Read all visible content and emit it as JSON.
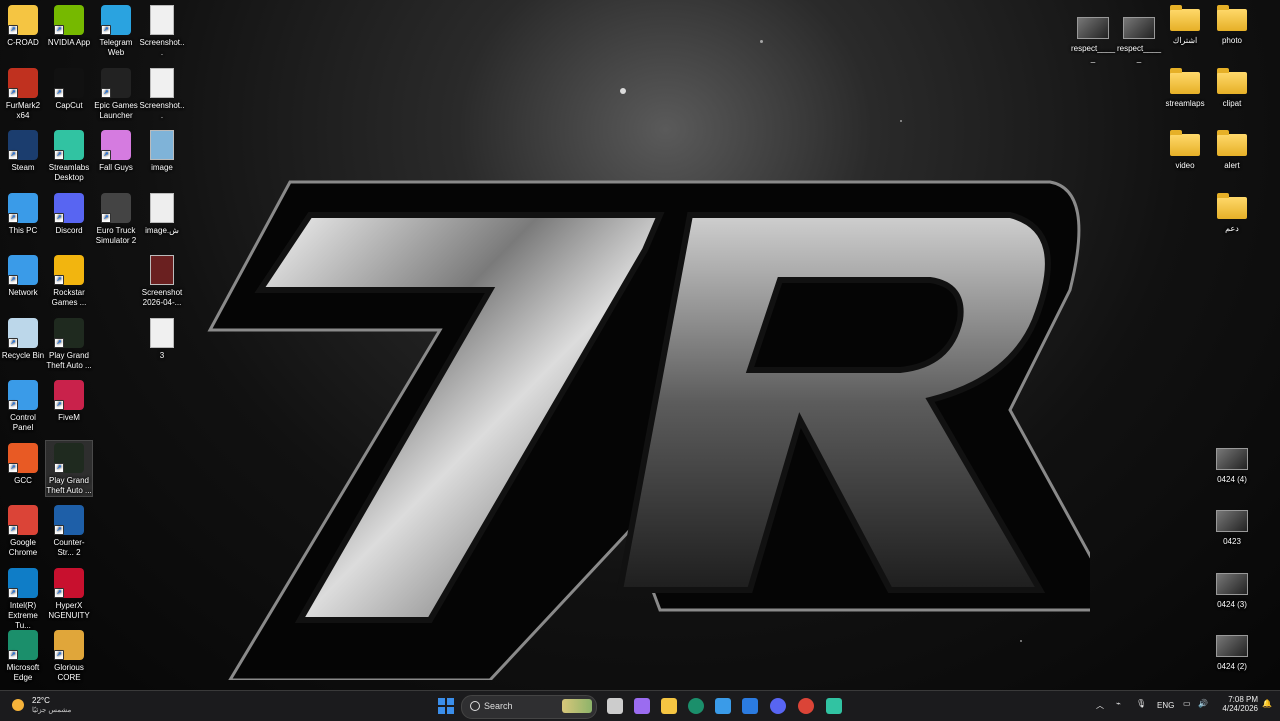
{
  "desktop_left": [
    {
      "label": "C-ROAD",
      "icon": "c-road-folder-icon",
      "color": "#f5c542"
    },
    {
      "label": "NVIDIA App",
      "icon": "nvidia-icon",
      "color": "#76b900"
    },
    {
      "label": "Telegram Web",
      "icon": "telegram-icon",
      "color": "#2aa3e0"
    },
    {
      "label": "Screenshot...",
      "icon": "screenshot-file-icon",
      "color": "#f0f0f0"
    },
    {
      "label": "FurMark2 x64",
      "icon": "furmark-icon",
      "color": "#c0311f"
    },
    {
      "label": "CapCut",
      "icon": "capcut-icon",
      "color": "#111111"
    },
    {
      "label": "Epic Games Launcher",
      "icon": "epic-games-icon",
      "color": "#222222"
    },
    {
      "label": "Screenshot...",
      "icon": "screenshot-file-icon",
      "color": "#f0f0f0"
    },
    {
      "label": "Steam",
      "icon": "steam-icon",
      "color": "#1b3d6e"
    },
    {
      "label": "Streamlabs Desktop",
      "icon": "streamlabs-icon",
      "color": "#31c3a2"
    },
    {
      "label": "Fall Guys",
      "icon": "fall-guys-icon",
      "color": "#d57be0"
    },
    {
      "label": "image",
      "icon": "image-file-icon",
      "color": "#7fb3d8"
    },
    {
      "label": "This PC",
      "icon": "this-pc-icon",
      "color": "#3a9be8"
    },
    {
      "label": "Discord",
      "icon": "discord-icon",
      "color": "#5865f2"
    },
    {
      "label": "Euro Truck Simulator 2",
      "icon": "euro-truck-icon",
      "color": "#444444"
    },
    {
      "label": "image.ش",
      "icon": "image-file-icon",
      "color": "#eeeeee"
    },
    {
      "label": "Network",
      "icon": "network-icon",
      "color": "#3a9be8"
    },
    {
      "label": "Rockstar Games ...",
      "icon": "rockstar-icon",
      "color": "#f2b50f"
    },
    {
      "label": "Screenshot 2026-04-...",
      "icon": "screenshot-file-icon",
      "color": "#6a2020"
    },
    {
      "label": "Recycle Bin",
      "icon": "recycle-bin-icon",
      "color": "#bcd7ea"
    },
    {
      "label": "Play Grand Theft Auto ...",
      "icon": "gta-v-icon",
      "color": "#1f2a1f"
    },
    {
      "label": "3",
      "icon": "image-file-icon",
      "color": "#f0f0f0"
    },
    {
      "label": "Control Panel",
      "icon": "control-panel-icon",
      "color": "#3a9be8"
    },
    {
      "label": "FiveM",
      "icon": "fivem-icon",
      "color": "#c9224b"
    },
    {
      "label": "GCC",
      "icon": "gcc-icon",
      "color": "#e85a24"
    },
    {
      "label": "Play Grand Theft Auto ...",
      "icon": "gta-v-icon",
      "color": "#1f2a1f"
    },
    {
      "label": "Google Chrome",
      "icon": "chrome-icon",
      "color": "#db4437"
    },
    {
      "label": "Counter-Str... 2",
      "icon": "cs2-icon",
      "color": "#1e5fa8"
    },
    {
      "label": "Intel(R) Extreme Tu...",
      "icon": "intel-xtu-icon",
      "color": "#0f7dc7"
    },
    {
      "label": "HyperX NGENUITY",
      "icon": "hyperx-icon",
      "color": "#c8102e"
    },
    {
      "label": "Microsoft Edge",
      "icon": "edge-icon",
      "color": "#1b8f6b"
    },
    {
      "label": "Glorious CORE",
      "icon": "glorious-icon",
      "color": "#e0a63a"
    }
  ],
  "desktop_right": [
    {
      "label": "respect_____",
      "icon": "thumbnail-icon",
      "type": "thumb"
    },
    {
      "label": "respect_____",
      "icon": "thumbnail-icon",
      "type": "thumb"
    },
    {
      "label": "اشتراك",
      "icon": "folder-icon",
      "type": "folder"
    },
    {
      "label": "photo",
      "icon": "folder-icon",
      "type": "folder"
    },
    {
      "label": "streamlaps",
      "icon": "folder-icon",
      "type": "folder"
    },
    {
      "label": "clipat",
      "icon": "folder-icon",
      "type": "folder"
    },
    {
      "label": "video",
      "icon": "folder-icon",
      "type": "folder"
    },
    {
      "label": "alert",
      "icon": "folder-icon",
      "type": "folder"
    },
    {
      "label": "دعم",
      "icon": "folder-icon",
      "type": "folder"
    },
    {
      "label": "0424 (4)",
      "icon": "video-thumbnail-icon",
      "type": "thumb"
    },
    {
      "label": "0423",
      "icon": "video-thumbnail-icon",
      "type": "thumb"
    },
    {
      "label": "0424 (3)",
      "icon": "video-thumbnail-icon",
      "type": "thumb"
    },
    {
      "label": "0424 (2)",
      "icon": "video-thumbnail-icon",
      "type": "thumb"
    }
  ],
  "wallpaper": {
    "logo_text": "7R"
  },
  "taskbar": {
    "weather_temp": "22°C",
    "weather_desc": "مشمس جزئيًا",
    "search_placeholder": "Search",
    "apps": [
      {
        "name": "start-button",
        "icon": "windows-icon",
        "color": "#3b8eea"
      },
      {
        "name": "task-view-button",
        "icon": "task-view-icon",
        "color": "#cccccc"
      },
      {
        "name": "copilot-button",
        "icon": "copilot-icon",
        "color": "#9b6cf0"
      },
      {
        "name": "file-explorer-button",
        "icon": "folder-icon",
        "color": "#f5c542"
      },
      {
        "name": "edge-button",
        "icon": "edge-icon",
        "color": "#1b8f6b"
      },
      {
        "name": "store-button",
        "icon": "store-icon",
        "color": "#3a9be8"
      },
      {
        "name": "mail-button",
        "icon": "mail-icon",
        "color": "#2b7be0"
      },
      {
        "name": "discord-button",
        "icon": "discord-icon",
        "color": "#5865f2"
      },
      {
        "name": "chrome-button",
        "icon": "chrome-icon",
        "color": "#db4437"
      },
      {
        "name": "streamlabs-button",
        "icon": "streamlabs-icon",
        "color": "#31c3a2"
      }
    ],
    "language": "ENG",
    "time": "7:08 PM",
    "date": "4/24/2026"
  }
}
